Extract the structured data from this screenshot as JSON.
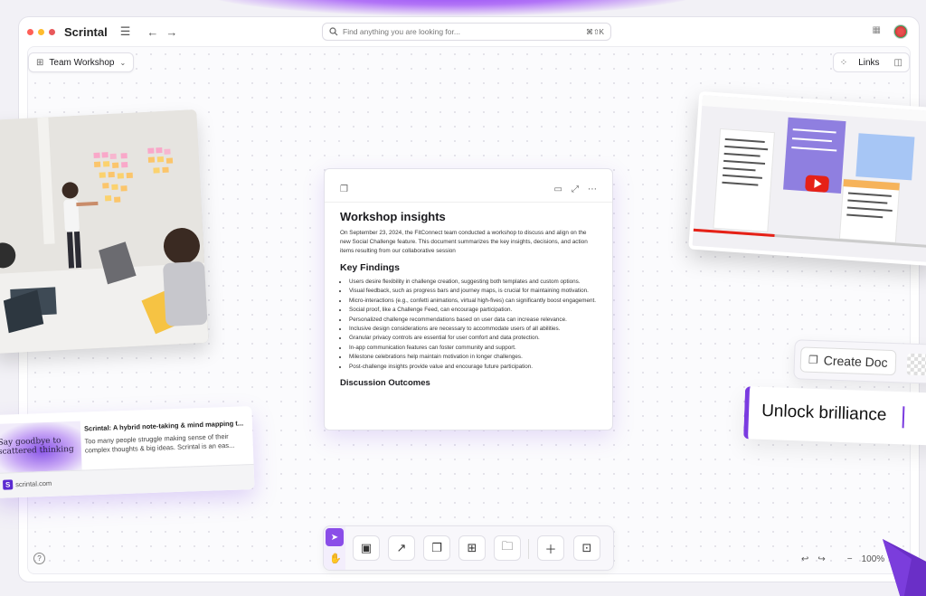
{
  "app": {
    "brand": "Scrintal",
    "search_placeholder": "Find anything you are looking for...",
    "search_shortcut": "⌘⇧K",
    "window_dot_colors": [
      "#ff5f57",
      "#febc2e",
      "#e8585b"
    ]
  },
  "workspace": {
    "name": "Team Workshop"
  },
  "links_label": "Links",
  "doc": {
    "title": "Workshop insights",
    "intro": "On September 23, 2024, the FitConnect team conducted a workshop to discuss and align on the new Social Challenge feature. This document summarizes the key insights, decisions, and action items resulting from our collaborative session",
    "key_findings_heading": "Key Findings",
    "findings": [
      "Users desire flexibility in challenge creation, suggesting both templates and custom options.",
      "Visual feedback, such as progress bars and journey maps, is crucial for maintaining motivation.",
      "Micro-interactions (e.g., confetti animations, virtual high-fives) can significantly boost engagement.",
      "Social proof, like a Challenge Feed, can encourage participation.",
      "Personalized challenge recommendations based on user data can increase relevance.",
      "Inclusive design considerations are necessary to accommodate users of all abilities.",
      "Granular privacy controls are essential for user comfort and data protection.",
      "In-app communication features can foster community and support.",
      "Milestone celebrations help maintain motivation in longer challenges.",
      "Post-challenge insights provide value and encourage future participation."
    ],
    "outcomes_heading": "Discussion Outcomes"
  },
  "link_card": {
    "thumb_text": "Say goodbye to scattered thinking",
    "title": "Scrintal: A hybrid note-taking & mind mapping t...",
    "description": "Too many people struggle making sense of their complex thoughts & big ideas. Scrintal is an eas...",
    "domain": "scrintal.com",
    "favicon_letter": "S"
  },
  "create_doc": {
    "label": "Create Doc"
  },
  "unlock": {
    "text": "Unlock brilliance"
  },
  "zoom": {
    "level": "100%"
  },
  "help_label": "?",
  "colors": {
    "accent": "#7a3be0",
    "accent_light": "#a774f0",
    "sticky": "#f9a8c9"
  }
}
